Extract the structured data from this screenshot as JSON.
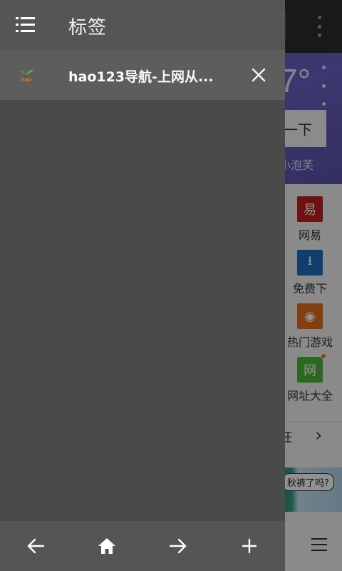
{
  "drawer": {
    "title": "标签",
    "tabs": [
      {
        "title": "hao123导航-上网从...",
        "favicon": "hao123-logo-icon",
        "favicon_text": "hao"
      }
    ],
    "bottom_nav": [
      {
        "name": "back",
        "icon": "arrow-left-icon"
      },
      {
        "name": "home",
        "icon": "home-icon"
      },
      {
        "name": "forward",
        "icon": "arrow-right-icon"
      },
      {
        "name": "new-tab",
        "icon": "plus-icon"
      }
    ]
  },
  "background_page": {
    "temperature": "7°",
    "search_button": "一下",
    "weather_tag": "小泡芙",
    "sites": [
      {
        "label": "网易",
        "icon_char": "易",
        "color": "#c21e1e"
      },
      {
        "label": "免费下",
        "icon_char": "⭳",
        "color": "#1f6fc0"
      },
      {
        "label": "热门游戏",
        "icon_char": "◉",
        "color": "#e86f1d"
      },
      {
        "label": "网址大全",
        "icon_char": "网",
        "color": "#4fb83a"
      }
    ],
    "more_text": "狂",
    "banner_text": "秋裤了吗?"
  },
  "colors": {
    "drawer_bg": "#4a4a4a",
    "drawer_header": "#555555",
    "tab_item_bg": "#5d5d5d"
  }
}
